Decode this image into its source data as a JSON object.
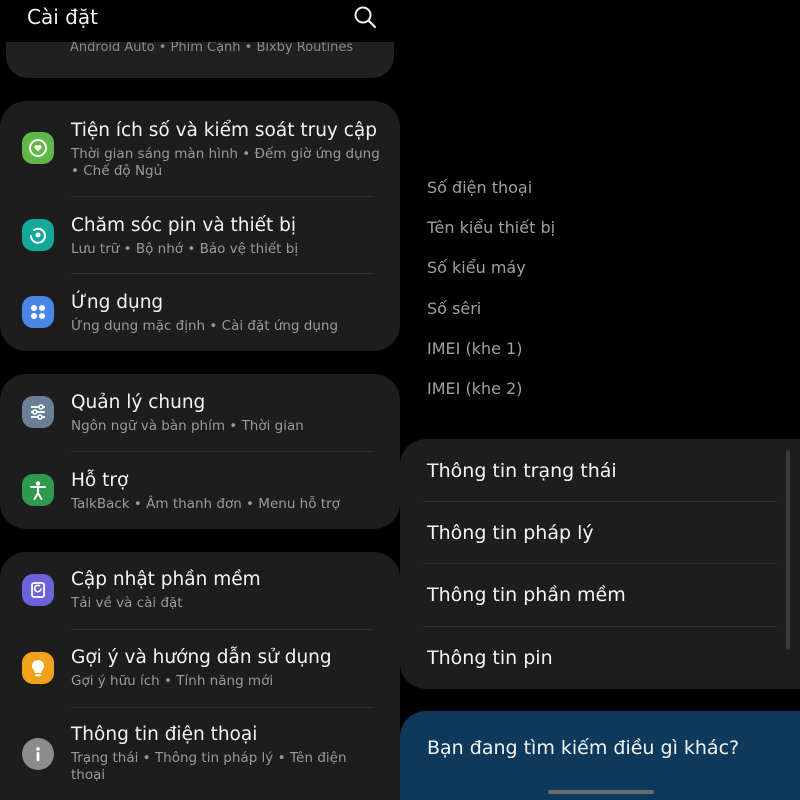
{
  "header": {
    "title": "Cài đặt",
    "icon": "search-icon"
  },
  "peek": {
    "text": "Android Auto  •  Phím Cạnh  •  Bixby Routines"
  },
  "settings": [
    {
      "title": "Tiện ích số và kiểm soát truy cập",
      "subtitle": "Thời gian sáng màn hình  •  Đếm giờ ứng dụng  •  Chế độ Ngủ",
      "icon": "digital-wellbeing-icon",
      "color": "#5fb848"
    },
    {
      "title": "Chăm sóc pin và thiết bị",
      "subtitle": "Lưu trữ  •  Bộ nhớ  •  Bảo vệ thiết bị",
      "icon": "device-care-icon",
      "color": "#12a99a"
    },
    {
      "title": "Ứng dụng",
      "subtitle": "Ứng dụng mặc định  •  Cài đặt ứng dụng",
      "icon": "apps-icon",
      "color": "#4a86e8"
    },
    {
      "title": "Quản lý chung",
      "subtitle": "Ngôn ngữ và bàn phím  •  Thời gian",
      "icon": "sliders-icon",
      "color": "#6b7f96"
    },
    {
      "title": "Hỗ trợ",
      "subtitle": "TalkBack  •  Âm thanh đơn  •  Menu hỗ trợ",
      "icon": "accessibility-icon",
      "color": "#2e9a4e"
    },
    {
      "title": "Cập nhật phần mềm",
      "subtitle": "Tải về và cài đặt",
      "icon": "software-update-icon",
      "color": "#6c63d8"
    },
    {
      "title": "Gợi ý và hướng dẫn sử dụng",
      "subtitle": "Gợi ý hữu ích  •  Tính năng mới",
      "icon": "lightbulb-icon",
      "color": "#f0a21c"
    },
    {
      "title": "Thông tin điện thoại",
      "subtitle": "Trạng thái  •  Thông tin pháp lý  •  Tên điện thoại",
      "icon": "info-icon",
      "color": "#8c8c8c"
    }
  ],
  "phone_info": [
    "Số điện thoại",
    "Tên kiểu thiết bị",
    "Số kiểu máy",
    "Số sêri",
    "IMEI (khe 1)",
    "IMEI (khe 2)"
  ],
  "info_menu": [
    "Thông tin trạng thái",
    "Thông tin pháp lý",
    "Thông tin phần mềm",
    "Thông tin pin"
  ],
  "search_prompt": {
    "text": "Bạn đang tìm kiếm điều gì khác?"
  }
}
